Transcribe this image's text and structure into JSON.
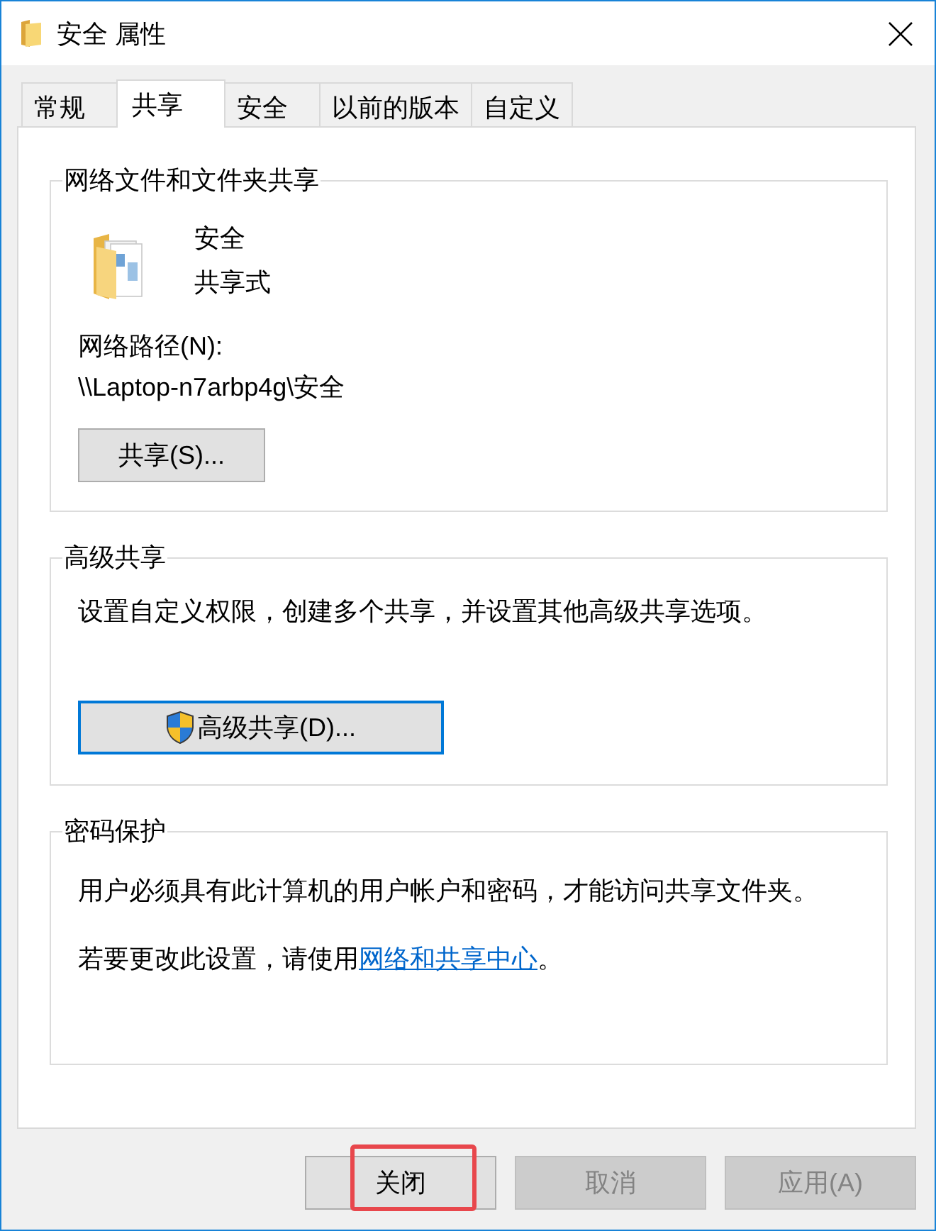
{
  "window": {
    "title": "安全 属性"
  },
  "tabs": [
    {
      "label": "常规",
      "selected": false
    },
    {
      "label": "共享",
      "selected": true
    },
    {
      "label": "安全",
      "selected": false
    },
    {
      "label": "以前的版本",
      "selected": false
    },
    {
      "label": "自定义",
      "selected": false
    }
  ],
  "groups": [
    {
      "kind": "network_share",
      "title": "网络文件和文件夹共享",
      "folder_name": "安全",
      "share_status": "共享式",
      "path_label": "网络路径(N):",
      "path": "\\\\Laptop-n7arbp4g\\安全",
      "button": {
        "label": "共享(S)...",
        "default": false
      }
    },
    {
      "kind": "advanced_share",
      "title": "高级共享",
      "description": "设置自定义权限，创建多个共享，并设置其他高级共享选项。",
      "button": {
        "label": "高级共享(D)...",
        "default": true,
        "shield": true
      }
    },
    {
      "kind": "password",
      "title": "密码保护",
      "paragraphs": [
        {
          "text": "用户必须具有此计算机的用户帐户和密码，才能访问共享文件夹。"
        },
        {
          "text": "若要更改此设置，请使用",
          "link": "网络和共享中心",
          "after": "。"
        }
      ]
    }
  ],
  "buttons": [
    {
      "label": "关闭",
      "disabled": false,
      "highlighted": true
    },
    {
      "label": "取消",
      "disabled": true,
      "highlighted": false
    },
    {
      "label": "应用(A)",
      "disabled": true,
      "highlighted": false
    }
  ]
}
